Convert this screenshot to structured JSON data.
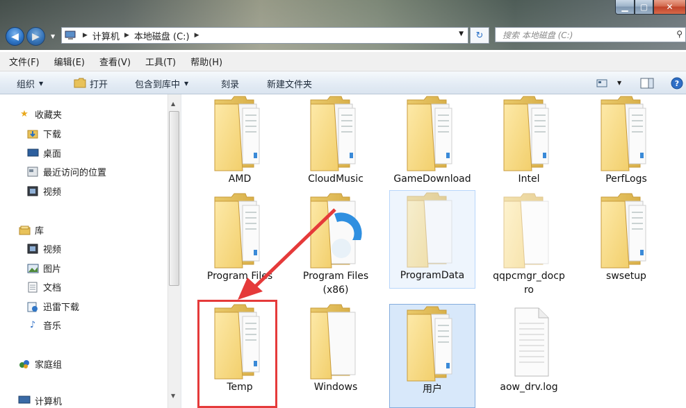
{
  "window": {
    "min_glyph": "▁",
    "max_glyph": "▢",
    "close_glyph": "✕"
  },
  "nav": {
    "back_glyph": "◀",
    "forward_glyph": "▶",
    "breadcrumb": [
      "计算机",
      "本地磁盘 (C:)"
    ],
    "search_placeholder": "搜索 本地磁盘 (C:)"
  },
  "menu": [
    "文件(F)",
    "编辑(E)",
    "查看(V)",
    "工具(T)",
    "帮助(H)"
  ],
  "toolbar": {
    "organize": "组织",
    "open": "打开",
    "include_library": "包含到库中",
    "burn": "刻录",
    "new_folder": "新建文件夹"
  },
  "sidebar": {
    "favorites": {
      "title": "收藏夹",
      "items": [
        "下载",
        "桌面",
        "最近访问的位置",
        "视频"
      ]
    },
    "libraries": {
      "title": "库",
      "items": [
        "视频",
        "图片",
        "文档",
        "迅雷下载",
        "音乐"
      ]
    },
    "homegroup": "家庭组",
    "computer": "计算机"
  },
  "files": [
    {
      "name": "AMD"
    },
    {
      "name": "CloudMusic"
    },
    {
      "name": "GameDownload"
    },
    {
      "name": "Intel"
    },
    {
      "name": "PerfLogs"
    },
    {
      "name": "Program Files"
    },
    {
      "name_line1": "Program Files",
      "name_line2": "(x86)"
    },
    {
      "name": "ProgramData"
    },
    {
      "name_line1": "qqpcmgr_docp",
      "name_line2": "ro"
    },
    {
      "name": "swsetup"
    },
    {
      "name": "Temp"
    },
    {
      "name": "Windows"
    },
    {
      "name": "用户"
    },
    {
      "name": "aow_drv.log"
    }
  ],
  "colors": {
    "highlight_box": "#e53a3a",
    "selection": "#d8e8fa",
    "accent": "#2f76c7"
  }
}
